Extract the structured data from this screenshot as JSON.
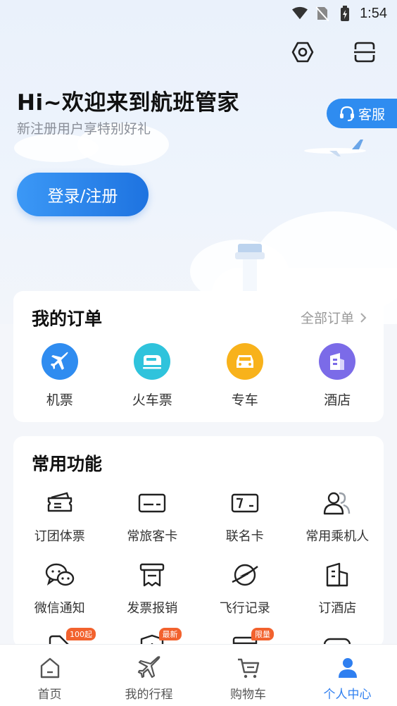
{
  "status_bar": {
    "time": "1:54"
  },
  "header": {
    "title": "Hi~欢迎来到航班管家",
    "subtitle": "新注册用户享特别好礼",
    "customer_service_label": "客服",
    "login_label": "登录/注册"
  },
  "orders": {
    "title": "我的订单",
    "all_orders_label": "全部订单",
    "items": [
      {
        "label": "机票",
        "icon": "airplane-icon",
        "color": "#2f8cf0"
      },
      {
        "label": "火车票",
        "icon": "train-icon",
        "color": "#2fc3dc"
      },
      {
        "label": "专车",
        "icon": "car-icon",
        "color": "#f8b21b"
      },
      {
        "label": "酒店",
        "icon": "hotel-icon",
        "color": "#7b6be8"
      }
    ]
  },
  "functions": {
    "title": "常用功能",
    "items": [
      {
        "label": "订团体票",
        "icon": "group-ticket-icon"
      },
      {
        "label": "常旅客卡",
        "icon": "frequent-flyer-card-icon"
      },
      {
        "label": "联名卡",
        "icon": "co-brand-card-icon"
      },
      {
        "label": "常用乘机人",
        "icon": "passengers-icon"
      },
      {
        "label": "微信通知",
        "icon": "wechat-icon"
      },
      {
        "label": "发票报销",
        "icon": "invoice-icon"
      },
      {
        "label": "飞行记录",
        "icon": "flight-record-icon"
      },
      {
        "label": "订酒店",
        "icon": "book-hotel-icon"
      },
      {
        "label": "",
        "icon": "tag-icon",
        "badge": "100起"
      },
      {
        "label": "",
        "icon": "insurance-icon",
        "badge": "最新"
      },
      {
        "label": "",
        "icon": "box-icon",
        "badge": "限量"
      },
      {
        "label": "",
        "icon": "game-icon"
      }
    ]
  },
  "tabbar": {
    "items": [
      {
        "label": "首页",
        "icon": "home-icon"
      },
      {
        "label": "我的行程",
        "icon": "trip-icon"
      },
      {
        "label": "购物车",
        "icon": "cart-icon"
      },
      {
        "label": "个人中心",
        "icon": "profile-icon",
        "active": true
      }
    ]
  },
  "colors": {
    "accent": "#2f7ff0",
    "badge": "#f2622e"
  }
}
